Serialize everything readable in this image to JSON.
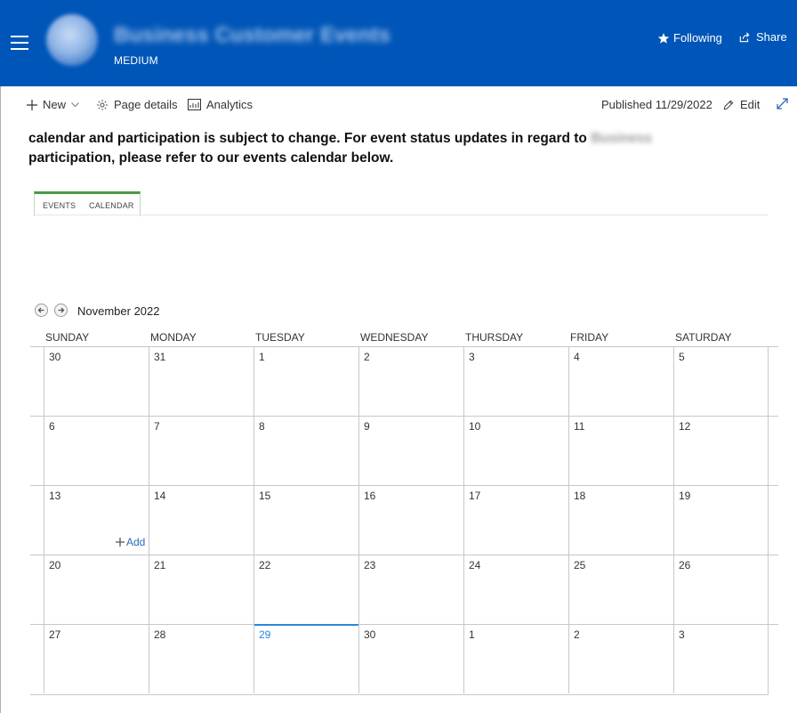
{
  "header": {
    "site_subtitle": "MEDIUM",
    "following_label": "Following",
    "share_label": "Share"
  },
  "commandbar": {
    "new_label": "New",
    "page_details_label": "Page details",
    "analytics_label": "Analytics",
    "published_label": "Published 11/29/2022",
    "edit_label": "Edit"
  },
  "content": {
    "line1": "calendar and participation is subject to change. For event status updates in regard to",
    "line2": "participation, please refer to our events calendar below."
  },
  "tabs": {
    "events": "EVENTS",
    "calendar": "CALENDAR"
  },
  "calendar": {
    "month": "November 2022",
    "days": [
      "SUNDAY",
      "MONDAY",
      "TUESDAY",
      "WEDNESDAY",
      "THURSDAY",
      "FRIDAY",
      "SATURDAY"
    ],
    "weeks": [
      [
        "30",
        "31",
        "1",
        "2",
        "3",
        "4",
        "5"
      ],
      [
        "6",
        "7",
        "8",
        "9",
        "10",
        "11",
        "12"
      ],
      [
        "13",
        "14",
        "15",
        "16",
        "17",
        "18",
        "19"
      ],
      [
        "20",
        "21",
        "22",
        "23",
        "24",
        "25",
        "26"
      ],
      [
        "27",
        "28",
        "29",
        "30",
        "1",
        "2",
        "3"
      ]
    ],
    "today": "29",
    "add_label": "Add"
  },
  "colors": {
    "brand": "#0056b8",
    "today": "#2b88d8",
    "tab_accent": "#4a9a4a",
    "link": "#2a6ab8"
  },
  "icons": {
    "menu": "hamburger-icon",
    "follow": "star-icon",
    "share": "share-icon",
    "new": "plus-icon",
    "page_details": "gear-icon",
    "analytics": "chart-icon",
    "edit": "pencil-icon",
    "expand": "expand-icon",
    "prev": "arrow-left-icon",
    "next": "arrow-right-icon",
    "add": "plus-icon"
  }
}
